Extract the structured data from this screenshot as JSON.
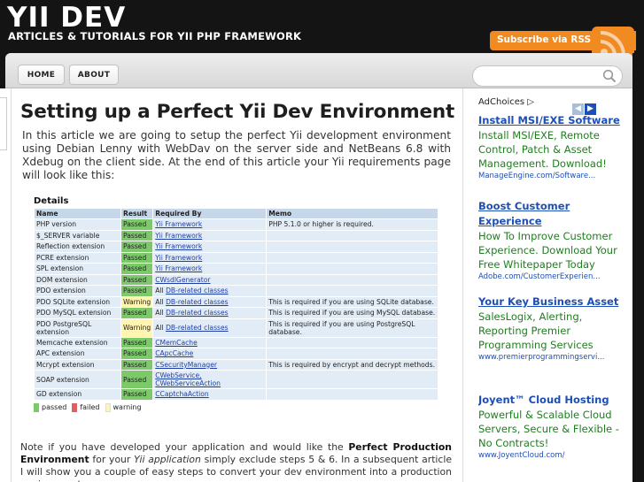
{
  "header": {
    "brand": "YII DEV",
    "tagline": "ARTICLES & TUTORIALS FOR YII PHP FRAMEWORK",
    "rss_label": "Subscribe via RSS"
  },
  "nav": {
    "items": [
      {
        "label": "HOME"
      },
      {
        "label": "ABOUT"
      }
    ],
    "search_placeholder": ""
  },
  "article": {
    "title": "Setting up a Perfect Yii Dev Environment",
    "intro": "In this article we are going to setup the perfect Yii development environment using Debian Lenny with WebDav on the server side and NetBeans 6.8 with Xdebug on the client side.  At the end of this article your Yii requirements page will look like this:",
    "outro": {
      "p1": "Note if you have developed your application and would like the ",
      "b1": "Perfect Production Environment",
      "p2": " for your ",
      "i1": "Yii application",
      "p3": " simply exclude steps 5 & 6. In a subsequent article I will show you a couple of easy steps to convert your dev environment into a production environment."
    }
  },
  "requirements": {
    "heading": "Details",
    "columns": [
      "Name",
      "Result",
      "Required By",
      "Memo"
    ],
    "rows": [
      {
        "name": "PHP version",
        "result": "Passed",
        "all": "",
        "required_by": "Yii Framework",
        "memo": "PHP 5.1.0 or higher is required."
      },
      {
        "name": "$_SERVER variable",
        "result": "Passed",
        "all": "",
        "required_by": "Yii Framework",
        "memo": ""
      },
      {
        "name": "Reflection extension",
        "result": "Passed",
        "all": "",
        "required_by": "Yii Framework",
        "memo": ""
      },
      {
        "name": "PCRE extension",
        "result": "Passed",
        "all": "",
        "required_by": "Yii Framework",
        "memo": ""
      },
      {
        "name": "SPL extension",
        "result": "Passed",
        "all": "",
        "required_by": "Yii Framework",
        "memo": ""
      },
      {
        "name": "DOM extension",
        "result": "Passed",
        "all": "",
        "required_by": "CWsdlGenerator",
        "memo": ""
      },
      {
        "name": "PDO extension",
        "result": "Passed",
        "all": "All ",
        "required_by": "DB-related classes",
        "memo": ""
      },
      {
        "name": "PDO SQLite extension",
        "result": "Warning",
        "all": "All ",
        "required_by": "DB-related classes",
        "memo": "This is required if you are using SQLite database."
      },
      {
        "name": "PDO MySQL extension",
        "result": "Passed",
        "all": "All ",
        "required_by": "DB-related classes",
        "memo": "This is required if you are using MySQL database."
      },
      {
        "name": "PDO PostgreSQL extension",
        "result": "Warning",
        "all": "All ",
        "required_by": "DB-related classes",
        "memo": "This is required if you are using PostgreSQL database."
      },
      {
        "name": "Memcache extension",
        "result": "Passed",
        "all": "",
        "required_by": "CMemCache",
        "memo": ""
      },
      {
        "name": "APC extension",
        "result": "Passed",
        "all": "",
        "required_by": "CApcCache",
        "memo": ""
      },
      {
        "name": "Mcrypt extension",
        "result": "Passed",
        "all": "",
        "required_by": "CSecurityManager",
        "memo": "This is required by encrypt and decrypt methods."
      },
      {
        "name": "SOAP extension",
        "result": "Passed",
        "all": "",
        "required_by": "CWebService,\nCWebServiceAction",
        "memo": ""
      },
      {
        "name": "GD extension",
        "result": "Passed",
        "all": "",
        "required_by": "CCaptchaAction",
        "memo": ""
      }
    ],
    "legend": [
      {
        "label": "passed",
        "color": "#7cc96a"
      },
      {
        "label": "failed",
        "color": "#e06060"
      },
      {
        "label": "warning",
        "color": "#fff4b0"
      }
    ]
  },
  "sidebar": {
    "adchoices": "AdChoices",
    "ads": [
      {
        "title": "Install MSI/EXE Software",
        "text": "Install MSI/EXE, Remote Control, Patch & Asset Management. Download!",
        "url": "ManageEngine.com/Software..."
      },
      {
        "title": "Boost Customer Experience",
        "text": "How To Improve Customer Experience. Download Your Free Whitepaper Today",
        "url": "Adobe.com/CustomerExperien..."
      },
      {
        "title": "Your Key Business Asset",
        "text": "SalesLogix, Alerting, Reporting Premier Programming Services",
        "url": "www.premierprogrammingservi..."
      },
      {
        "title": "Joyent™ Cloud Hosting",
        "text": "Powerful & Scalable Cloud Servers, Secure & Flexible - No Contracts!",
        "url": "www.JoyentCloud.com/"
      }
    ]
  },
  "colors": {
    "background": "#141414",
    "rss": "#f18a21",
    "ad_title": "#1d4fb5",
    "ad_text": "#1f7e1f",
    "passed": "#7cc96a",
    "warning": "#fff4b0"
  }
}
